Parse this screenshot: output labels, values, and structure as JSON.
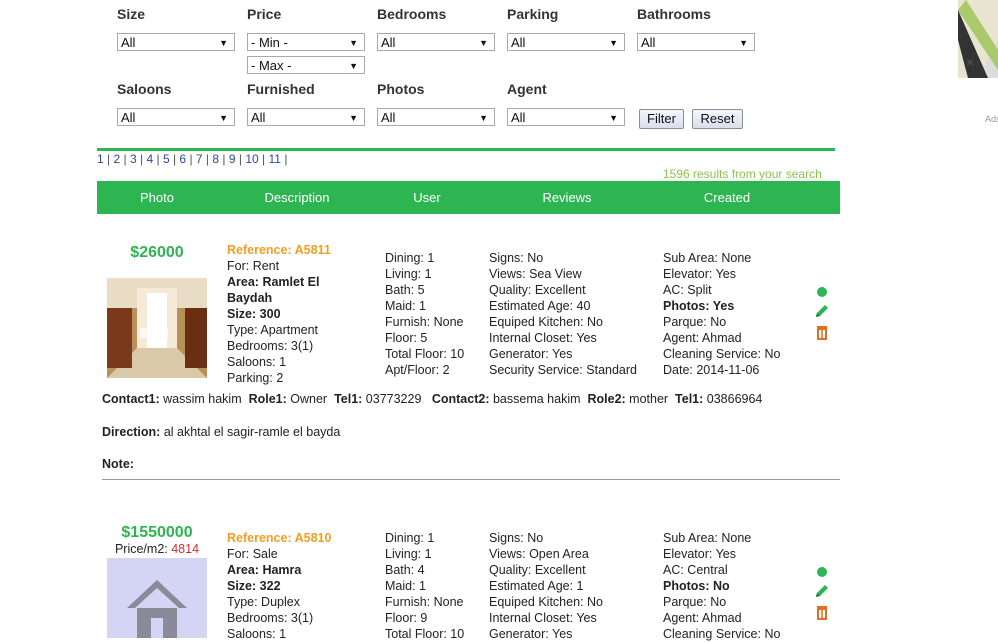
{
  "filters": {
    "row1": [
      {
        "label": "Size",
        "value": "All"
      },
      {
        "label": "Price",
        "value": "- Min -",
        "value2": "- Max -"
      },
      {
        "label": "Bedrooms",
        "value": "All"
      },
      {
        "label": "Parking",
        "value": "All"
      },
      {
        "label": "Bathrooms",
        "value": "All"
      }
    ],
    "row2": [
      {
        "label": "Saloons",
        "value": "All"
      },
      {
        "label": "Furnished",
        "value": "All"
      },
      {
        "label": "Photos",
        "value": "All"
      },
      {
        "label": "Agent",
        "value": "All"
      }
    ],
    "filter_label": "Filter",
    "reset_label": "Reset"
  },
  "pager": [
    "1",
    "2",
    "3",
    "4",
    "5",
    "6",
    "7",
    "8",
    "9",
    "10",
    "11"
  ],
  "results_text": "1596 results from your search",
  "table_headers": [
    "Photo",
    "Description",
    "User",
    "Reviews",
    "Created"
  ],
  "ad": {
    "close": "×",
    "label": "Ads"
  },
  "listings": [
    {
      "price": "$26000",
      "price_m2_label": "",
      "price_m2": "",
      "reference": "Reference: A5811",
      "for": "For: Rent",
      "area_label": "Area:",
      "area": "Ramlet El Baydah",
      "size_label": "Size:",
      "size": "300",
      "type": "Type: Apartment",
      "bedrooms": "Bedrooms: 3(1)",
      "saloons": "Saloons: 1",
      "parking": "Parking: 2",
      "col2": [
        "Dining: 1",
        "Living: 1",
        "Bath: 5",
        "Maid: 1",
        "Furnish: None",
        "Floor: 5",
        "Total Floor: 10",
        "Apt/Floor: 2"
      ],
      "col3": [
        "Signs: No",
        "Views: Sea View",
        "Quality: Excellent",
        "Estimated Age: 40",
        "Equiped Kitchen: No",
        "Internal Closet: Yes",
        "Generator: Yes",
        "Security Service: Standard"
      ],
      "col4": [
        "Sub Area: None",
        "Elevator: Yes",
        "AC: Split",
        "Photos: Yes",
        "Parque: No",
        "Agent: Ahmad",
        "Cleaning Service: No",
        "Date: 2014-11-06"
      ],
      "contact": {
        "c1_label": "Contact1:",
        "c1": "wassim hakim",
        "r1_label": "Role1:",
        "r1": "Owner",
        "t1_label": "Tel1:",
        "t1": "03773229",
        "c2_label": "Contact2:",
        "c2": "bassema hakim",
        "r2_label": "Role2:",
        "r2": "mother",
        "t2_label": "Tel1:",
        "t2": "03866964"
      },
      "direction_label": "Direction:",
      "direction": "al akhtal el sagir-ramle el bayda",
      "note_label": "Note:",
      "photo": "interior-photo"
    },
    {
      "price": "$1550000",
      "price_m2_label": "Price/m2:",
      "price_m2": "4814",
      "reference": "Reference: A5810",
      "for": "For: Sale",
      "area_label": "Area:",
      "area": "Hamra",
      "size_label": "Size:",
      "size": "322",
      "type": "Type: Duplex",
      "bedrooms": "Bedrooms: 3(1)",
      "saloons": "Saloons: 1",
      "parking": "",
      "col2": [
        "Dining: 1",
        "Living: 1",
        "Bath: 4",
        "Maid: 1",
        "Furnish: None",
        "Floor: 9",
        "Total Floor: 10"
      ],
      "col3": [
        "Signs: No",
        "Views: Open Area",
        "Quality: Excellent",
        "Estimated Age: 1",
        "Equiped Kitchen: No",
        "Internal Closet: Yes",
        "Generator: Yes"
      ],
      "col4": [
        "Sub Area: None",
        "Elevator: Yes",
        "AC: Central",
        "Photos: No",
        "Parque: No",
        "Agent: Ahmad",
        "Cleaning Service: No"
      ],
      "photo": "house-placeholder-icon"
    }
  ],
  "colors": {
    "accent": "#2db552",
    "reference": "#f0a020",
    "results": "#8bc34a",
    "delete": "#e07020"
  }
}
